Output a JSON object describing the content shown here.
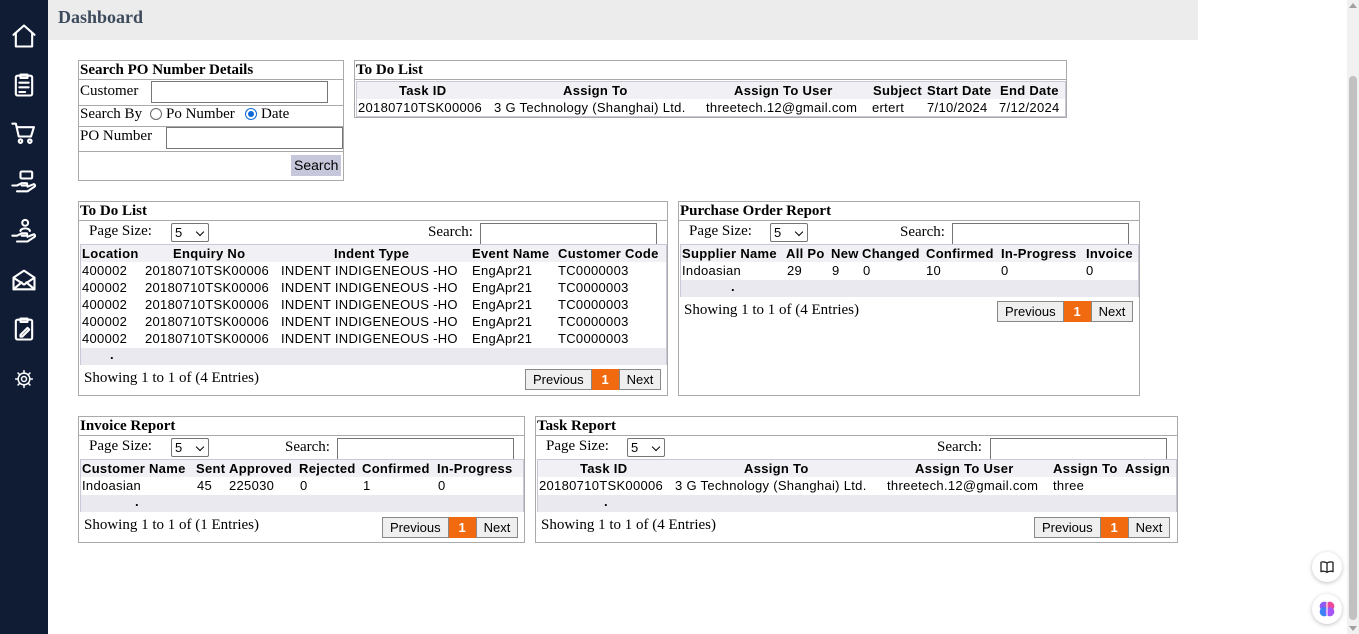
{
  "header": {
    "title": "Dashboard"
  },
  "nav": [
    {
      "icon": "home-icon"
    },
    {
      "icon": "clipboard-list-icon"
    },
    {
      "icon": "shopping-cart-icon"
    },
    {
      "icon": "hand-money-icon"
    },
    {
      "icon": "hand-user-icon"
    },
    {
      "icon": "envelope-icon"
    },
    {
      "icon": "clipboard-edit-icon"
    },
    {
      "icon": "gear-icon"
    }
  ],
  "search_po": {
    "title": "Search PO Number Details",
    "customer_label": "Customer",
    "customer_value": "",
    "search_by_label": "Search By",
    "opt_po": "Po Number",
    "opt_date": "Date",
    "selected": "Date",
    "po_label": "PO Number",
    "po_value": "",
    "search_button": "Search"
  },
  "todo_top": {
    "title": "To Do List",
    "columns": [
      "Task ID",
      "Assign To",
      "Assign To User",
      "Subject",
      "Start Date",
      "End Date"
    ],
    "rows": [
      [
        "20180710TSK00006",
        "3 G Technology (Shanghai) Ltd.",
        "threetech.12@gmail.com",
        "ertert",
        "7/10/2024",
        "7/12/2024"
      ]
    ]
  },
  "todo_list": {
    "title": "To Do List",
    "page_size_label": "Page Size:",
    "page_size": "5",
    "search_label": "Search:",
    "columns": [
      "Location",
      "Enquiry No",
      "Indent Type",
      "Event Name",
      "Customer Code"
    ],
    "rows": [
      [
        "400002",
        "20180710TSK00006",
        "INDENT INDIGENEOUS -HO",
        "EngApr21",
        "TC0000003"
      ],
      [
        "400002",
        "20180710TSK00006",
        "INDENT INDIGENEOUS -HO",
        "EngApr21",
        "TC0000003"
      ],
      [
        "400002",
        "20180710TSK00006",
        "INDENT INDIGENEOUS -HO",
        "EngApr21",
        "TC0000003"
      ],
      [
        "400002",
        "20180710TSK00006",
        "INDENT INDIGENEOUS -HO",
        "EngApr21",
        "TC0000003"
      ],
      [
        "400002",
        "20180710TSK00006",
        "INDENT INDIGENEOUS -HO",
        "EngApr21",
        "TC0000003"
      ]
    ],
    "dot": ".",
    "showing": "Showing 1 to 1 of (4 Entries)",
    "prev": "Previous",
    "page": "1",
    "next": "Next"
  },
  "po_report": {
    "title": "Purchase Order Report",
    "page_size_label": "Page Size:",
    "page_size": "5",
    "search_label": "Search:",
    "columns": [
      "Supplier Name",
      "All Po",
      "New",
      "Changed",
      "Confirmed",
      "In-Progress",
      "Invoice"
    ],
    "rows": [
      [
        "Indoasian",
        "29",
        "9",
        "0",
        "10",
        "0",
        "0"
      ]
    ],
    "dot": ".",
    "showing": "Showing 1 to 1 of (4 Entries)",
    "prev": "Previous",
    "page": "1",
    "next": "Next"
  },
  "invoice_report": {
    "title": "Invoice Report",
    "page_size_label": "Page Size:",
    "page_size": "5",
    "search_label": "Search:",
    "columns": [
      "Customer Name",
      "Sent",
      "Approved",
      "Rejected",
      "Confirmed",
      "In-Progress"
    ],
    "rows": [
      [
        "Indoasian",
        "45",
        "225030",
        "0",
        "1",
        "0"
      ]
    ],
    "dot": ".",
    "showing": "Showing 1 to 1 of (1 Entries)",
    "prev": "Previous",
    "page": "1",
    "next": "Next"
  },
  "task_report": {
    "title": "Task Report",
    "page_size_label": "Page Size:",
    "page_size": "5",
    "search_label": "Search:",
    "columns": [
      "Task ID",
      "Assign To",
      "Assign To User",
      "Assign To",
      "Assign"
    ],
    "rows": [
      [
        "20180710TSK00006",
        "3 G Technology (Shanghai) Ltd.",
        "threetech.12@gmail.com",
        "three",
        ""
      ]
    ],
    "dot": ".",
    "showing": "Showing 1 to 1 of (4 Entries)",
    "prev": "Previous",
    "page": "1",
    "next": "Next"
  },
  "floating": [
    {
      "icon": "book-icon"
    },
    {
      "icon": "brain-icon"
    }
  ],
  "colors": {
    "sidebar": "#0f1c34",
    "pager_active": "#f26a10",
    "header_bg": "#ececec"
  }
}
